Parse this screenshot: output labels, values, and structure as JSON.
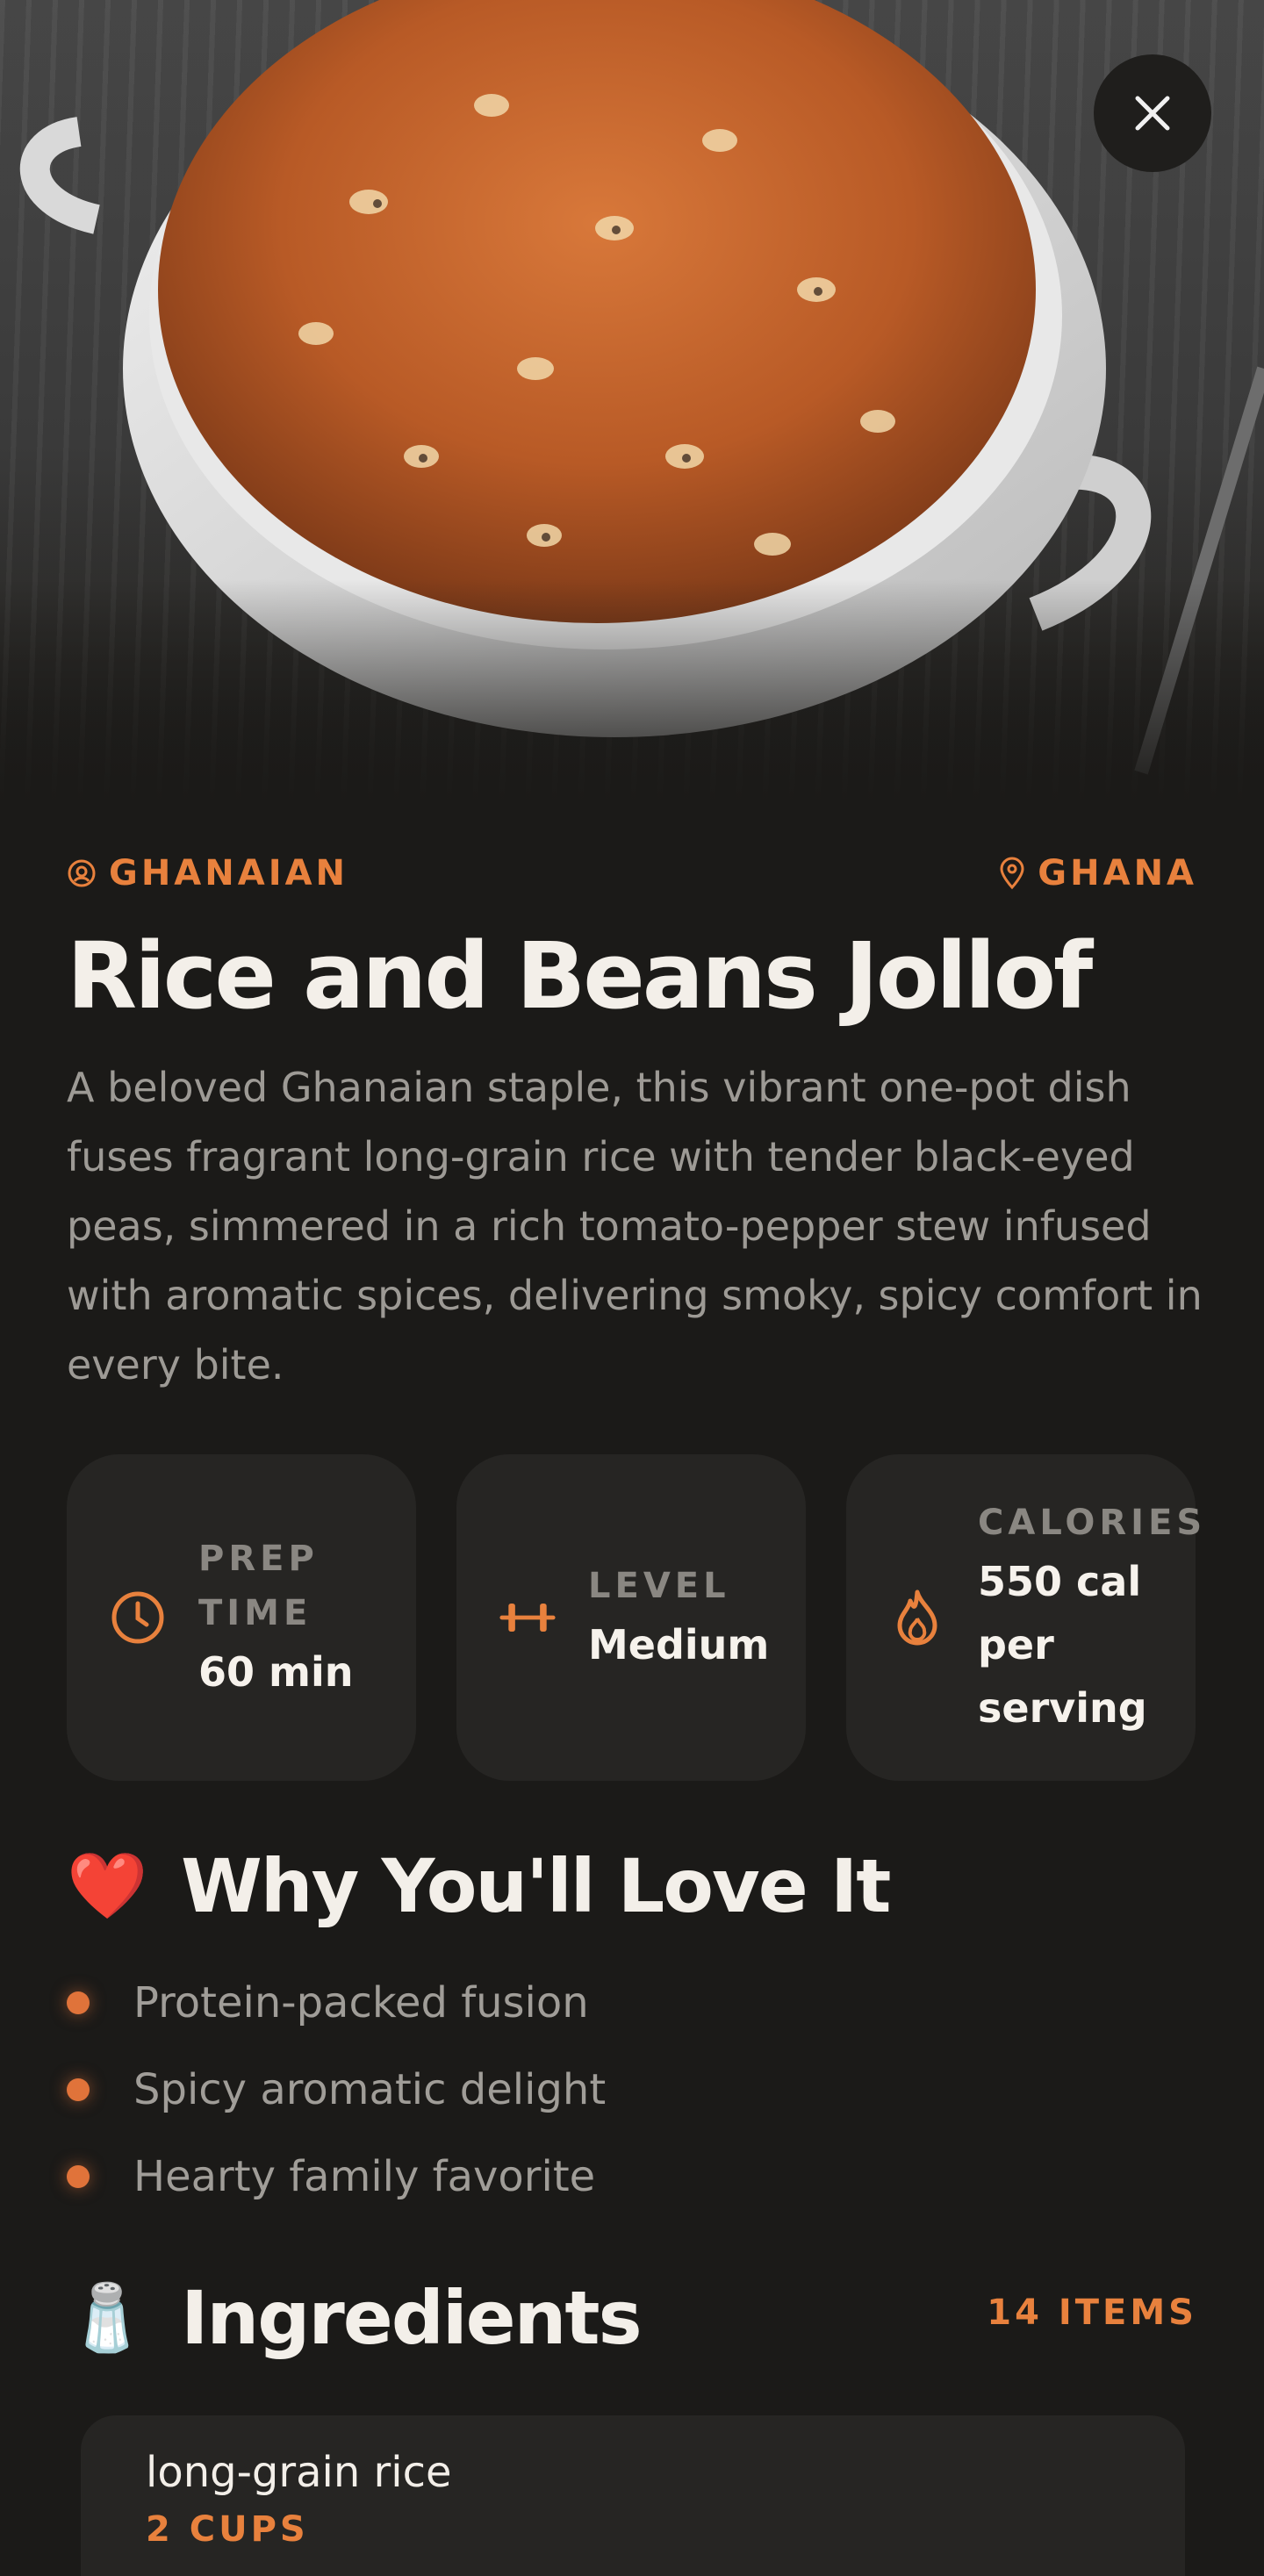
{
  "hero": {
    "image_alt": "Bowl of rice and beans jollof",
    "close_icon": "close-icon"
  },
  "meta": {
    "cuisine": "GHANAIAN",
    "cuisine_icon": "cuisine-badge-icon",
    "origin": "GHANA",
    "origin_icon": "location-pin-icon"
  },
  "recipe": {
    "title": "Rice and Beans Jollof",
    "description": "A beloved Ghanaian staple, this vibrant one-pot dish fuses fragrant long-grain rice with tender black-eyed peas, simmered in a rich tomato-pepper stew infused with aromatic spices, delivering smoky, spicy comfort in every bite."
  },
  "stats": [
    {
      "label": "PREP TIME",
      "value": "60 min",
      "icon": "clock-icon"
    },
    {
      "label": "LEVEL",
      "value": "Medium",
      "icon": "dumbbell-icon"
    },
    {
      "label": "CALORIES",
      "value": "550 cal per serving",
      "icon": "flame-icon"
    }
  ],
  "why": {
    "emoji": "❤️",
    "title": "Why You'll Love It",
    "items": [
      "Protein-packed fusion",
      "Spicy aromatic delight",
      "Hearty family favorite"
    ]
  },
  "ingredients": {
    "emoji": "🧂",
    "title": "Ingredients",
    "count": "14 ITEMS",
    "items": [
      {
        "name": "long-grain rice",
        "quantity": "2 CUPS"
      }
    ]
  },
  "colors": {
    "accent": "#e8813d",
    "background": "#1b1a18",
    "card": "#262523"
  }
}
